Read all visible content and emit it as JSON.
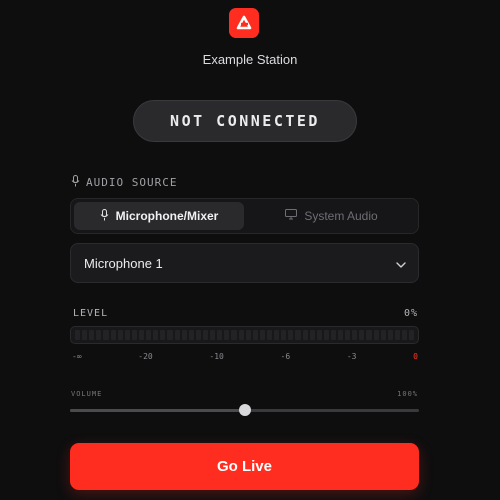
{
  "header": {
    "logo_icon": "brand-logo-icon",
    "station_name": "Example Station"
  },
  "connection": {
    "status": "NOT CONNECTED"
  },
  "audio_source": {
    "label": "AUDIO SOURCE",
    "icon": "microphone-icon",
    "options": [
      {
        "label": "Microphone/Mixer",
        "icon": "microphone-icon",
        "selected": true
      },
      {
        "label": "System Audio",
        "icon": "monitor-icon",
        "selected": false
      }
    ],
    "device": {
      "value": "Microphone 1",
      "icon": "chevron-down-icon"
    }
  },
  "level": {
    "label": "LEVEL",
    "value": "0%",
    "level_fraction": 0,
    "scale": [
      "-∞",
      "-20",
      "-10",
      "-6",
      "-3",
      "0"
    ]
  },
  "volume": {
    "label": "VOLUME",
    "value": "100%",
    "slider_fraction": 0.5
  },
  "action": {
    "go_live_label": "Go Live"
  },
  "colors": {
    "accent": "#ff2d1f",
    "background": "#0e0e0f",
    "peak": "#ff3322"
  }
}
